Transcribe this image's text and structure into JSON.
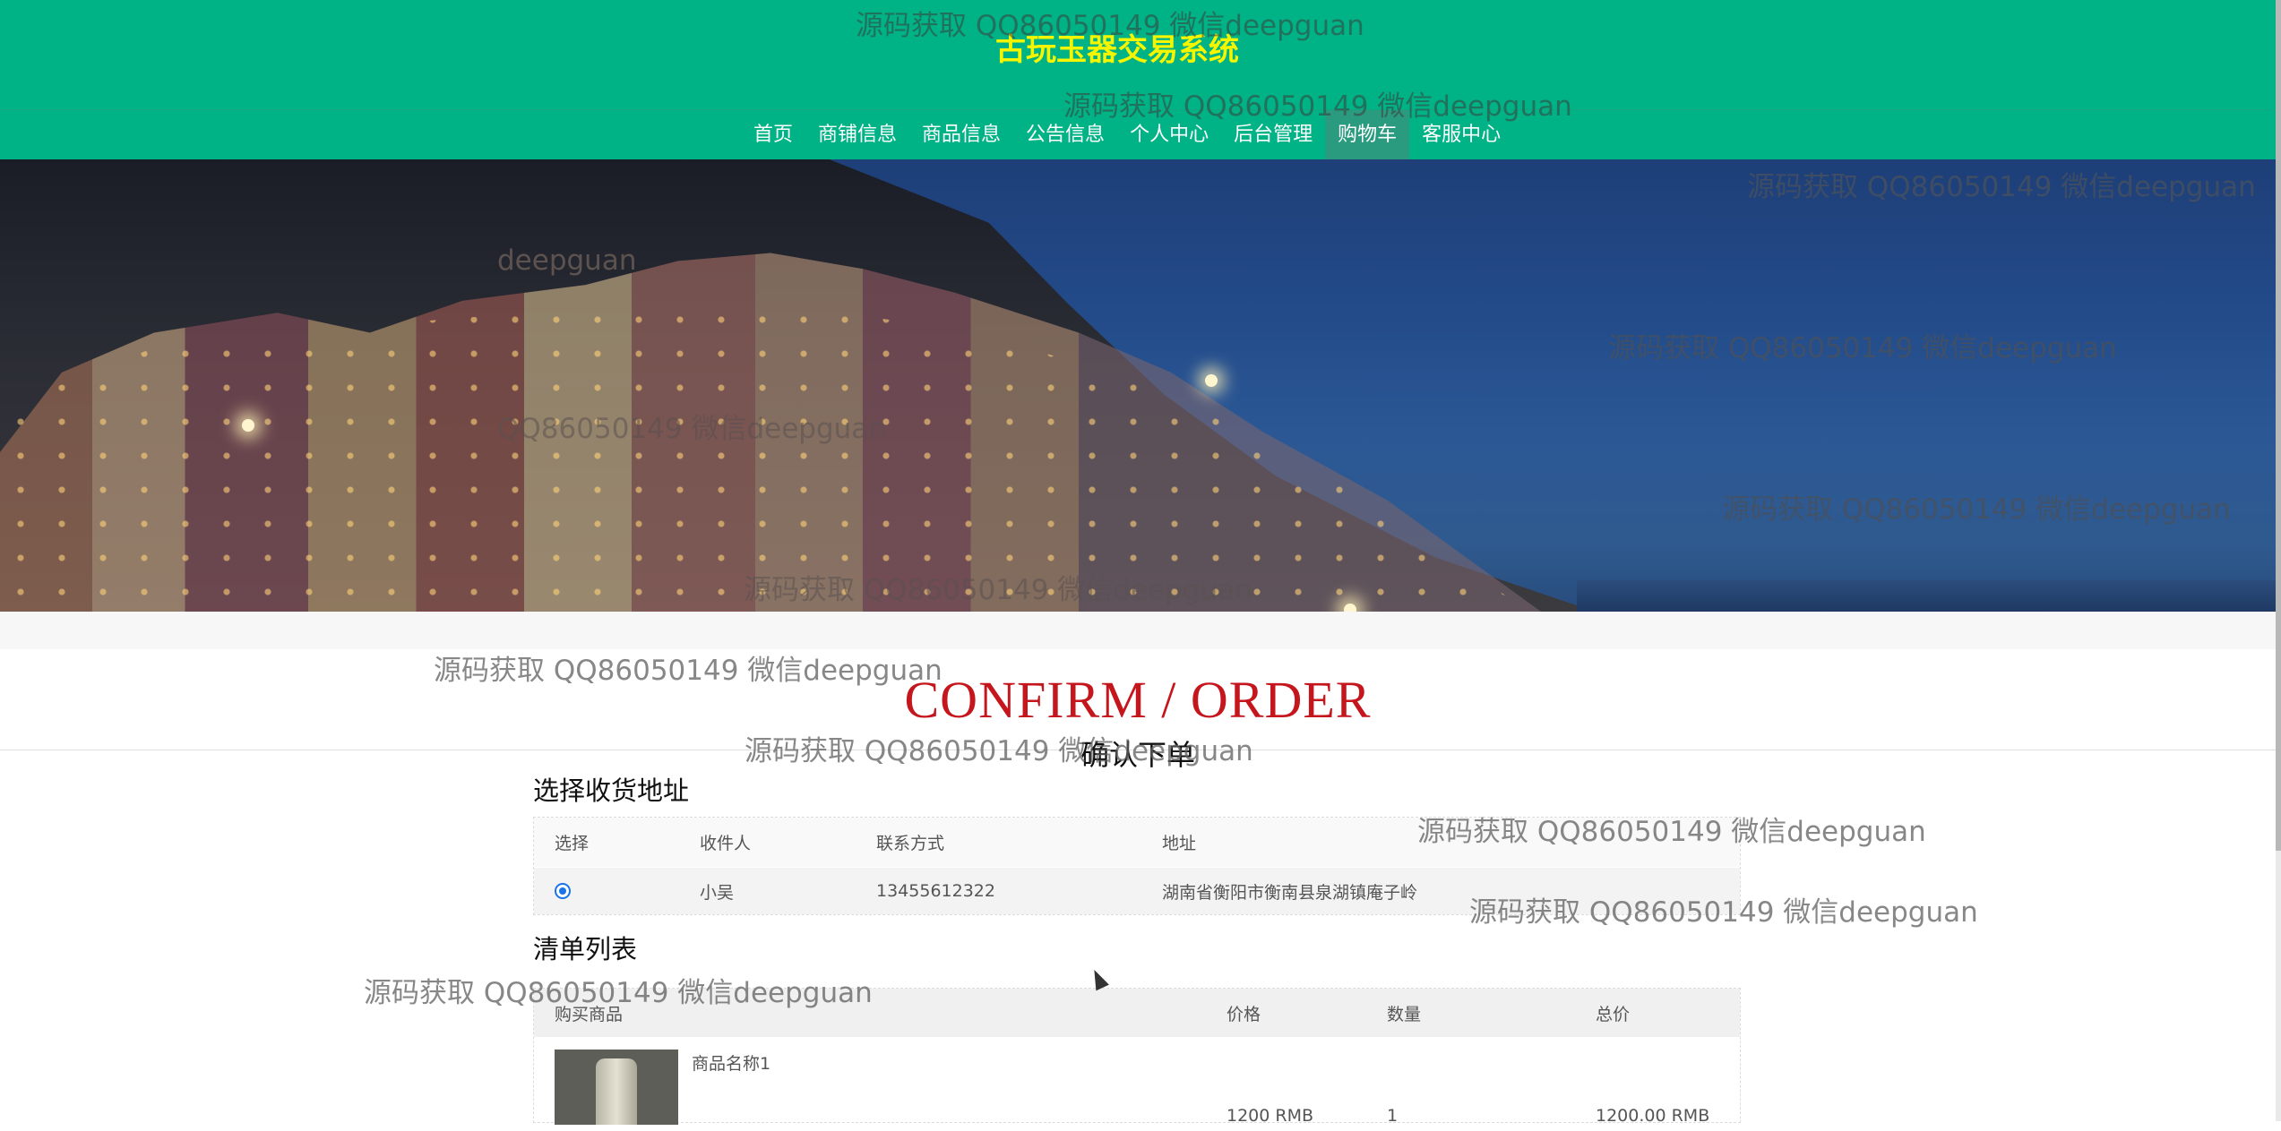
{
  "header": {
    "site_title": "古玩玉器交易系统"
  },
  "nav": {
    "items": [
      {
        "label": "首页"
      },
      {
        "label": "商铺信息"
      },
      {
        "label": "商品信息"
      },
      {
        "label": "公告信息"
      },
      {
        "label": "个人中心"
      },
      {
        "label": "后台管理"
      },
      {
        "label": "购物车",
        "active": true
      },
      {
        "label": "客服中心"
      }
    ]
  },
  "page": {
    "title_en": "CONFIRM / ORDER",
    "title_cn": "确认下单"
  },
  "address_section": {
    "title": "选择收货地址",
    "columns": [
      "选择",
      "收件人",
      "联系方式",
      "地址"
    ],
    "rows": [
      {
        "selected": true,
        "receiver": "小吴",
        "phone": "13455612322",
        "address": "湖南省衡阳市衡南县泉湖镇庵子岭"
      }
    ]
  },
  "order_list": {
    "title": "清单列表",
    "columns": [
      "购买商品",
      "价格",
      "数量",
      "总价"
    ],
    "items": [
      {
        "name": "商品名称1",
        "price": "1200 RMB",
        "quantity": "1",
        "total": "1200.00 RMB"
      }
    ]
  },
  "watermark": {
    "text": "源码获取 QQ86050149 微信deepguan",
    "partial_1": "deepguan",
    "partial_2": "QQ86050149 微信deepguan",
    "partial_3": "源码获取 QQ86050149 微信deepguan"
  },
  "colors": {
    "header_bg": "#00b386",
    "title_color": "#f5f500",
    "confirm_red": "#c4161c",
    "nav_active": "#2a9b7f"
  }
}
